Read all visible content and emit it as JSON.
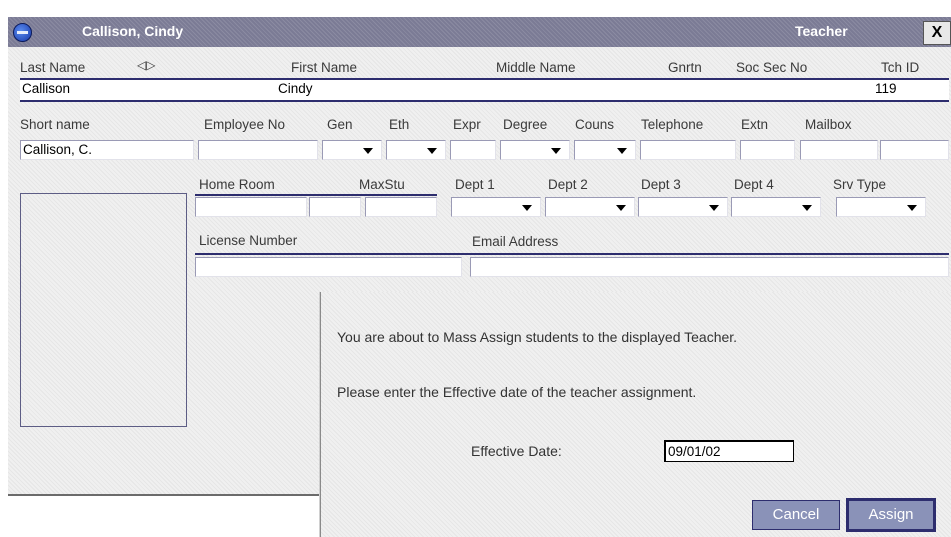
{
  "window": {
    "title_name": "Callison, Cindy",
    "title_role": "Teacher",
    "close_glyph": "X"
  },
  "fields": {
    "row1_labels": {
      "last_name": "Last Name",
      "swap_glyph": "◁▷",
      "first_name": "First Name",
      "middle_name": "Middle Name",
      "gnrtn": "Gnrtn",
      "soc_sec_no": "Soc Sec No",
      "tch_id": "Tch ID"
    },
    "row1_values": {
      "last_name": "Callison",
      "first_name": "Cindy",
      "middle_name": "",
      "gnrtn": "",
      "soc_sec_no": "",
      "tch_id": "119"
    },
    "row2_labels": {
      "short_name": "Short name",
      "employee_no": "Employee No",
      "gen": "Gen",
      "eth": "Eth",
      "expr": "Expr",
      "degree": "Degree",
      "couns": "Couns",
      "telephone": "Telephone",
      "extn": "Extn",
      "mailbox": "Mailbox"
    },
    "row2_values": {
      "short_name": "Callison, C.",
      "employee_no": "",
      "gen": "",
      "eth": "",
      "expr": "",
      "degree": "",
      "couns": "",
      "telephone": "",
      "extn": "",
      "mailbox": ""
    },
    "row3_labels": {
      "home_room": "Home Room",
      "maxstu": "MaxStu",
      "dept1": "Dept 1",
      "dept2": "Dept 2",
      "dept3": "Dept 3",
      "dept4": "Dept 4",
      "srv_type": "Srv Type"
    },
    "row4_labels": {
      "license_number": "License Number",
      "email_address": "Email Address"
    }
  },
  "dialog": {
    "message1": "You are about to Mass Assign students to the displayed Teacher.",
    "message2": "Please enter the Effective date of the teacher assignment.",
    "effective_date_label": "Effective Date:",
    "effective_date_value": "09/01/02",
    "cancel_label": "Cancel",
    "assign_label": "Assign"
  },
  "colors": {
    "titlebar": "#7b7b95",
    "accent_line": "#2d2d6e",
    "button_bg": "#8a92b8"
  },
  "icons": {
    "app": "app-globe-icon",
    "close": "close-icon",
    "dropdown": "dropdown-arrow-icon",
    "swap": "swap-arrows-icon"
  }
}
